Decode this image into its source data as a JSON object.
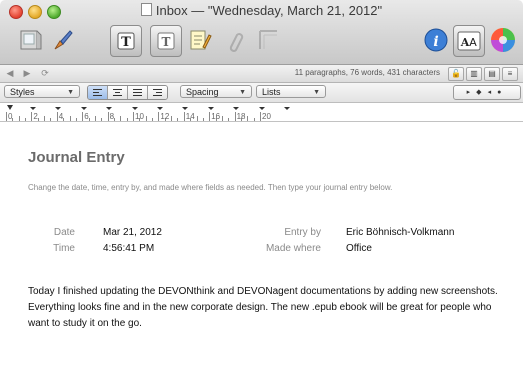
{
  "window": {
    "title": "Inbox — \"Wednesday, March 21, 2012\""
  },
  "toolbar": {
    "buttons": [
      {
        "name": "scanner-icon"
      },
      {
        "name": "brush-icon"
      },
      {
        "name": "format-text-icon"
      },
      {
        "name": "format-text-alt-icon"
      },
      {
        "name": "notepad-icon"
      },
      {
        "name": "link-icon"
      },
      {
        "name": "frame-icon"
      },
      {
        "name": "info-icon"
      },
      {
        "name": "fonts-icon"
      },
      {
        "name": "colors-icon"
      }
    ]
  },
  "statusbar": {
    "stats": "11 paragraphs, 76 words, 431 characters"
  },
  "format_bar": {
    "styles_label": "Styles",
    "spacing_label": "Spacing",
    "lists_label": "Lists"
  },
  "ruler": {
    "labels": [
      "0",
      "2",
      "4",
      "6",
      "8",
      "10",
      "12",
      "14",
      "16",
      "18",
      "20"
    ]
  },
  "document": {
    "heading": "Journal Entry",
    "instructions": "Change the date, time, entry by, and made where fields as needed. Then type your journal entry below.",
    "date_label": "Date",
    "date_value": "Mar 21, 2012",
    "time_label": "Time",
    "time_value": "4:56:41 PM",
    "entry_by_label": "Entry by",
    "entry_by_value": "Eric Böhnisch-Volkmann",
    "made_where_label": "Made where",
    "made_where_value": "Office",
    "body": "Today I finished updating the DEVONthink and DEVONagent documentations by adding new screenshots. Everything looks fine and in the new corporate design. The new .epub ebook will be great for people who want to study it on the go."
  }
}
